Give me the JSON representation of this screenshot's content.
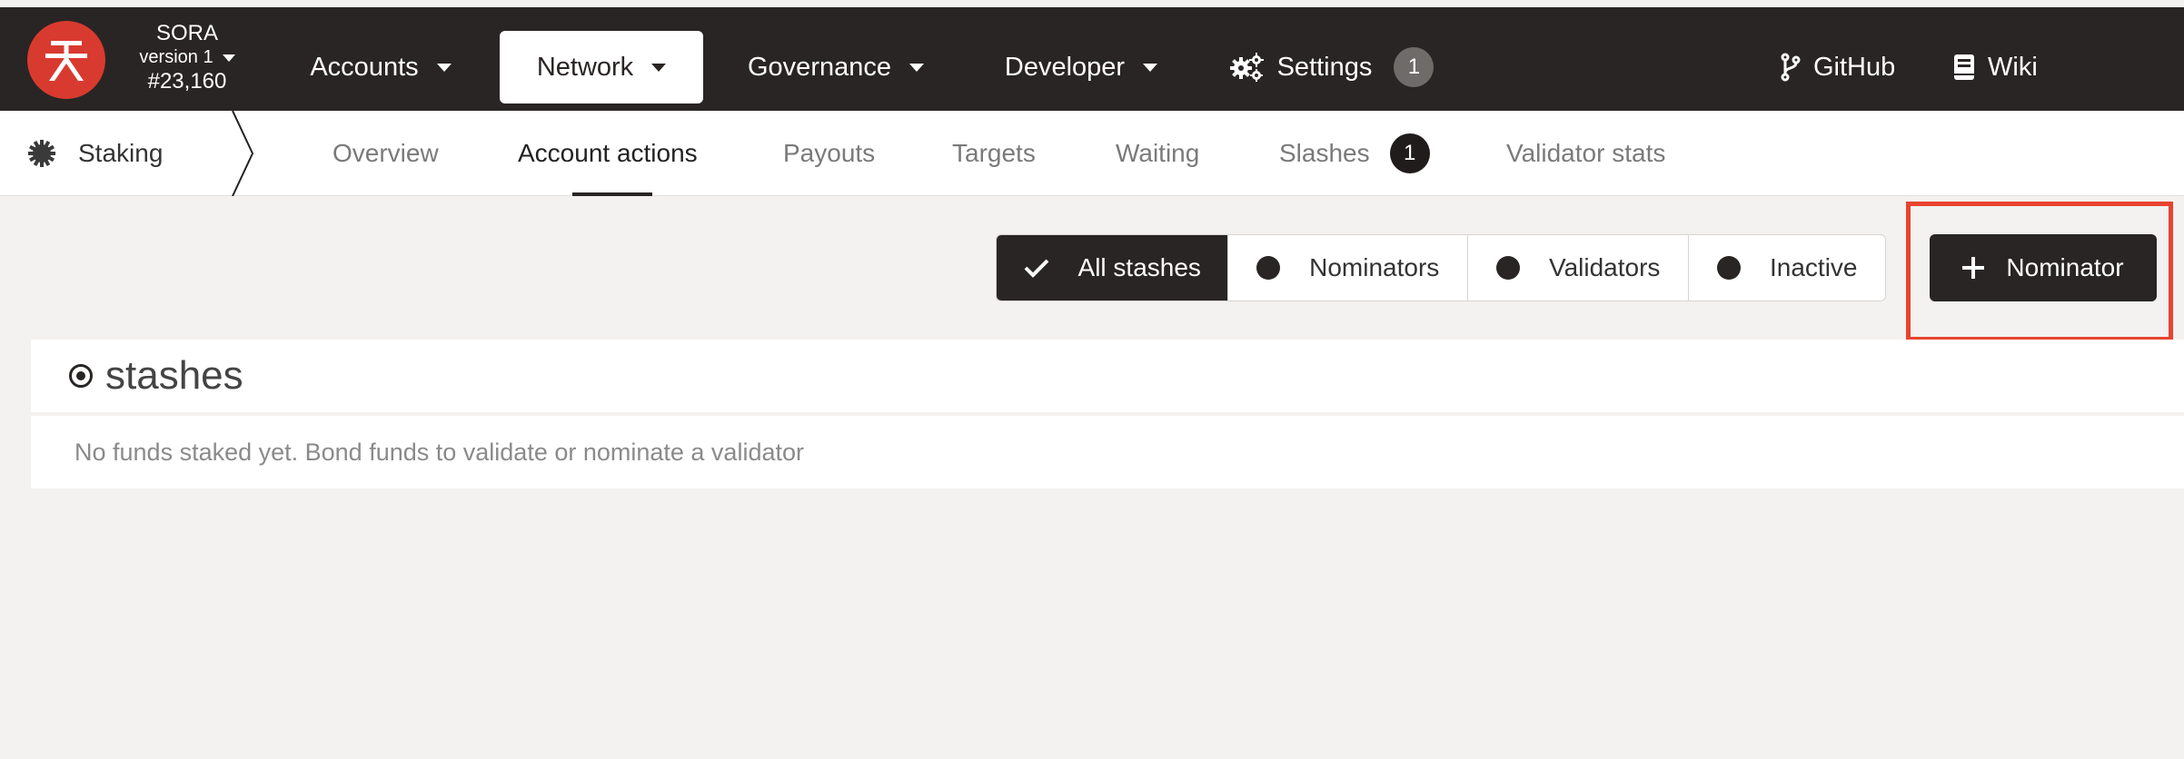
{
  "header": {
    "chain_name": "SORA",
    "version": "version 1",
    "block": "#23,160",
    "nav": [
      {
        "label": "Accounts"
      },
      {
        "label": "Network"
      },
      {
        "label": "Governance"
      },
      {
        "label": "Developer"
      }
    ],
    "settings": {
      "label": "Settings",
      "badge": "1"
    },
    "github": "GitHub",
    "wiki": "Wiki"
  },
  "subnav": {
    "section": "Staking",
    "tabs": [
      {
        "label": "Overview"
      },
      {
        "label": "Account actions"
      },
      {
        "label": "Payouts"
      },
      {
        "label": "Targets"
      },
      {
        "label": "Waiting"
      },
      {
        "label": "Slashes",
        "badge": "1"
      },
      {
        "label": "Validator stats"
      }
    ]
  },
  "filters": [
    {
      "label": "All stashes"
    },
    {
      "label": "Nominators"
    },
    {
      "label": "Validators"
    },
    {
      "label": "Inactive"
    }
  ],
  "add_button": {
    "label": "Nominator"
  },
  "stashes": {
    "title": "stashes",
    "empty_message": "No funds staked yet. Bond funds to validate or nominate a validator"
  },
  "colors": {
    "topbar": "#292524",
    "logo": "#d93a2f",
    "highlight": "#e8432f",
    "background": "#f3f2f1"
  }
}
